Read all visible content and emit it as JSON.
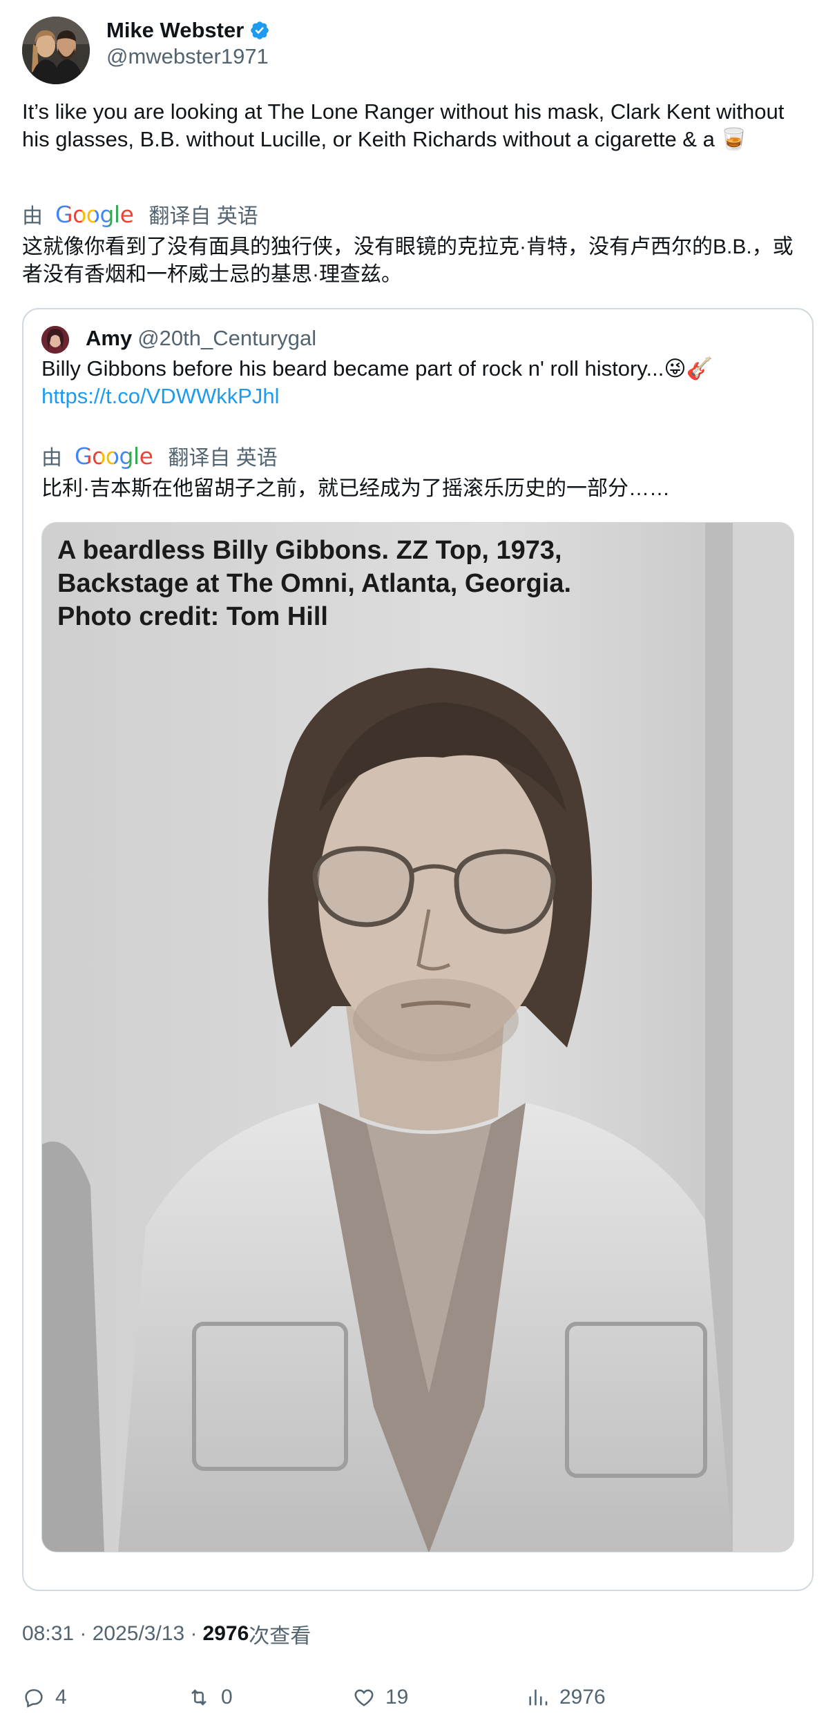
{
  "author": {
    "display_name": "Mike Webster",
    "handle": "@mwebster1971",
    "verified": true
  },
  "tweet": {
    "text": "It’s like you are looking at The Lone Ranger without his mask, Clark Kent without his glasses, B.B. without Lucille, or Keith Richards without a cigarette & a 🥃",
    "translation_prefix": "由",
    "translation_provider": "Google",
    "translation_suffix": "翻译自 英语",
    "translated_text": "这就像你看到了没有面具的独行侠，没有眼镜的克拉克·肯特，没有卢西尔的B.B.，或者没有香烟和一杯威士忌的基思·理查兹。"
  },
  "quoted": {
    "display_name": "Amy",
    "handle": "@20th_Centurygal",
    "text": "Billy Gibbons before his beard became part of rock n' roll history...😜🎸",
    "link": "https://t.co/VDWWkkPJhl",
    "translation_prefix": "由",
    "translation_provider": "Google",
    "translation_suffix": "翻译自 英语",
    "translated_text": "比利·吉本斯在他留胡子之前，就已经成为了摇滚乐历史的一部分……",
    "photo_caption_line1": "A beardless Billy Gibbons. ZZ Top, 1973,",
    "photo_caption_line2": "Backstage at The Omni, Atlanta, Georgia.",
    "photo_caption_line3": "Photo credit: Tom Hill"
  },
  "meta": {
    "time": "08:31 · 2025/3/13 ·",
    "views_count": "2976",
    "views_label": "次查看"
  },
  "actions": {
    "replies": "4",
    "reposts": "0",
    "likes": "19",
    "views": "2976"
  },
  "colors": {
    "text": "#0f1419",
    "secondary": "#536471",
    "link": "#1d9bf0",
    "verified": "#1d9bf0",
    "border": "#cfd9de"
  }
}
